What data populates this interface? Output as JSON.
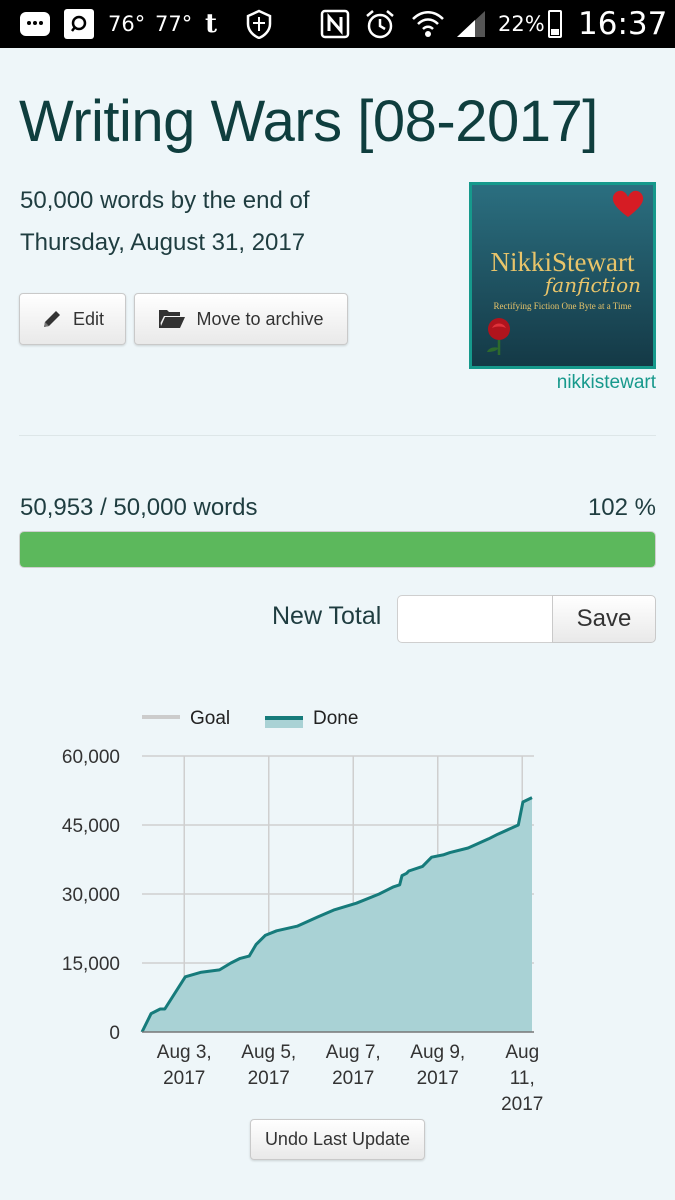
{
  "status_bar": {
    "temp1": "76°",
    "temp2": "77°",
    "tumblr": "t",
    "battery": "22%",
    "time": "16:37",
    "icons": [
      "chat-bubble-icon",
      "search-app-icon",
      "tumblr-icon",
      "shield-icon",
      "nfc-icon",
      "alarm-icon",
      "wifi-icon",
      "signal-icon",
      "battery-icon"
    ]
  },
  "page": {
    "title": "Writing Wars [08-2017]",
    "goal_line1": "50,000 words by the end of",
    "goal_line2": "Thursday, August 31, 2017",
    "edit_label": "Edit",
    "archive_label": "Move to archive",
    "avatar": {
      "name": "NikkiStewart",
      "script": "fanfiction",
      "tagline": "Rectifying Fiction One Byte at a Time",
      "username": "nikkistewart"
    }
  },
  "progress": {
    "count_text": "50,953 / 50,000 words",
    "percent_text": "102 %",
    "fraction": 1.0,
    "color": "#5cb85c"
  },
  "new_total": {
    "label": "New Total",
    "value": "",
    "placeholder": "",
    "save_label": "Save"
  },
  "chart_data": {
    "type": "area",
    "x_type": "date",
    "legend": [
      {
        "name": "Goal",
        "color": "#cccccc"
      },
      {
        "name": "Done",
        "color": "#167b7b"
      }
    ],
    "legend_position": "top-left",
    "grid": true,
    "ylim": [
      0,
      60000
    ],
    "yticks": [
      "0",
      "15,000",
      "30,000",
      "45,000",
      "60,000"
    ],
    "xticks": [
      [
        "Aug 3,",
        "2017"
      ],
      [
        "Aug 5,",
        "2017"
      ],
      [
        "Aug 7,",
        "2017"
      ],
      [
        "Aug 9,",
        "2017"
      ],
      [
        "Aug",
        "11,",
        "2017"
      ]
    ],
    "xlim": [
      "2017-08-02",
      "2017-08-11"
    ],
    "series": [
      {
        "name": "Done",
        "x": [
          "2017-08-02",
          "2017-08-02",
          "2017-08-02",
          "2017-08-02",
          "2017-08-03",
          "2017-08-03",
          "2017-08-03",
          "2017-08-04",
          "2017-08-04",
          "2017-08-04",
          "2017-08-04",
          "2017-08-05",
          "2017-08-05",
          "2017-08-05",
          "2017-08-05",
          "2017-08-06",
          "2017-08-06",
          "2017-08-06",
          "2017-08-07",
          "2017-08-07",
          "2017-08-07",
          "2017-08-07",
          "2017-08-07",
          "2017-08-07",
          "2017-08-08",
          "2017-08-08",
          "2017-08-08",
          "2017-08-09",
          "2017-08-10",
          "2017-08-10",
          "2017-08-11",
          "2017-08-11",
          "2017-08-11"
        ],
        "t": [
          0,
          0.2,
          0.4,
          0.5,
          0.95,
          1.3,
          1.7,
          1.95,
          2.15,
          2.35,
          2.5,
          2.7,
          2.95,
          3.4,
          3.85,
          4.2,
          4.7,
          5.2,
          5.5,
          5.65,
          5.7,
          5.8,
          5.85,
          6.15,
          6.35,
          6.6,
          6.75,
          7.15,
          7.6,
          7.8,
          8.25,
          8.35,
          8.55
        ],
        "values": [
          0,
          4000,
          5000,
          5000,
          12000,
          13000,
          13500,
          15000,
          16000,
          16500,
          19000,
          21000,
          22000,
          23000,
          25000,
          26500,
          28000,
          30000,
          31500,
          32000,
          34000,
          34500,
          35000,
          36000,
          38000,
          38500,
          39000,
          40000,
          42000,
          43000,
          45000,
          50000,
          50953
        ]
      }
    ]
  },
  "undo_label": "Undo Last Update"
}
